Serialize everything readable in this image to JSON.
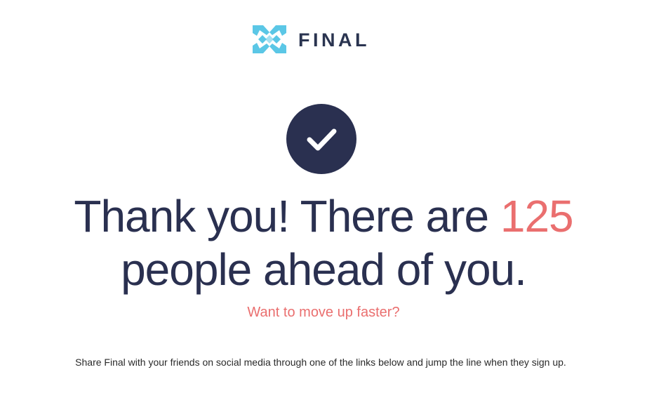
{
  "brand": {
    "name": "FINAL",
    "logo_icon": "final-logo-mark-icon",
    "logo_color": "#5bc7e6",
    "text_color": "#2a3450"
  },
  "confirmation": {
    "icon": "checkmark-icon",
    "circle_color": "#2a3050"
  },
  "headline": {
    "prefix": "Thank you! There are ",
    "count": "125",
    "line2": "people ahead of you.",
    "text_color": "#2a3050",
    "accent_color": "#ea6f6f"
  },
  "subhead": {
    "text": "Want to move up faster?"
  },
  "info": {
    "text": "Share Final with your friends on social media through one of the links below and jump the line when they sign up."
  }
}
